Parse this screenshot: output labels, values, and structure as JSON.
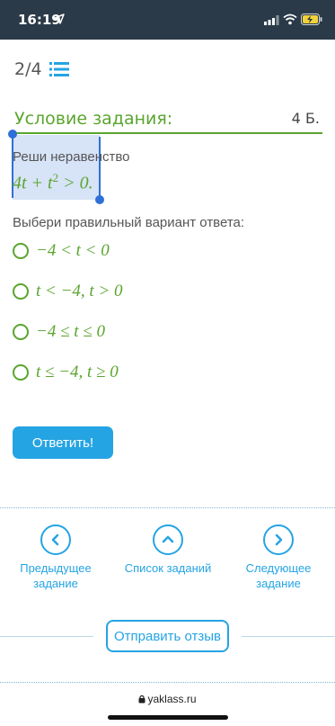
{
  "status_bar": {
    "time": "16:19"
  },
  "header": {
    "counter": "2/4"
  },
  "condition": {
    "title": "Условие задания:",
    "points": "4 Б.",
    "task_text": "Реши неравенство",
    "formula_main": "4t + t",
    "formula_exp": "2",
    "formula_tail": " > 0."
  },
  "prompt": "Выбери правильный вариант ответа:",
  "options": [
    {
      "label": "−4 < t < 0"
    },
    {
      "label": "t < −4,  t > 0"
    },
    {
      "label": "−4 ≤ t ≤ 0"
    },
    {
      "label": "t ≤ −4, t ≥ 0"
    }
  ],
  "answer_button": "Ответить!",
  "nav": {
    "prev_line1": "Предыдущее",
    "prev_line2": "задание",
    "list": "Список заданий",
    "next_line1": "Следующее",
    "next_line2": "задание"
  },
  "feedback_button": "Отправить отзыв",
  "footer_domain": "yaklass.ru",
  "colors": {
    "status_bg": "#2b3a48",
    "accent_green": "#5aa52f",
    "accent_blue": "#25a4e3",
    "selection": "#d7e3f7"
  },
  "icons": [
    "location-arrow-icon",
    "signal-icon",
    "wifi-icon",
    "battery-charging-icon",
    "list-icon",
    "chevron-left-icon",
    "chevron-up-icon",
    "chevron-right-icon",
    "lock-icon"
  ]
}
